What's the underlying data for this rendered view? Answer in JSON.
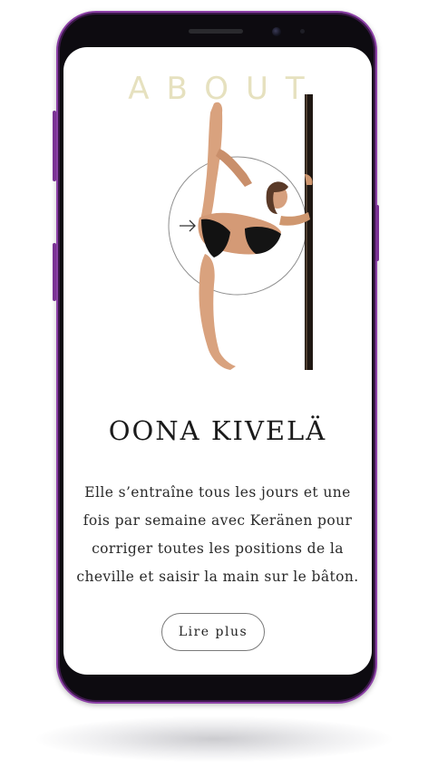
{
  "section": {
    "title": "ABOUT"
  },
  "profile": {
    "name": "OONA KIVELÄ",
    "description": "Elle s’entraîne tous les jours et une fois par semaine avec Keränen pour corriger toutes les positions de la cheville et saisir la main sur le bâton.",
    "read_more_label": "Lire plus"
  },
  "icons": {
    "next": "arrow-right-icon"
  },
  "colors": {
    "title_accent": "#e6e1bf",
    "device_frame": "#8b3fa6",
    "text": "#1b1b1b"
  }
}
